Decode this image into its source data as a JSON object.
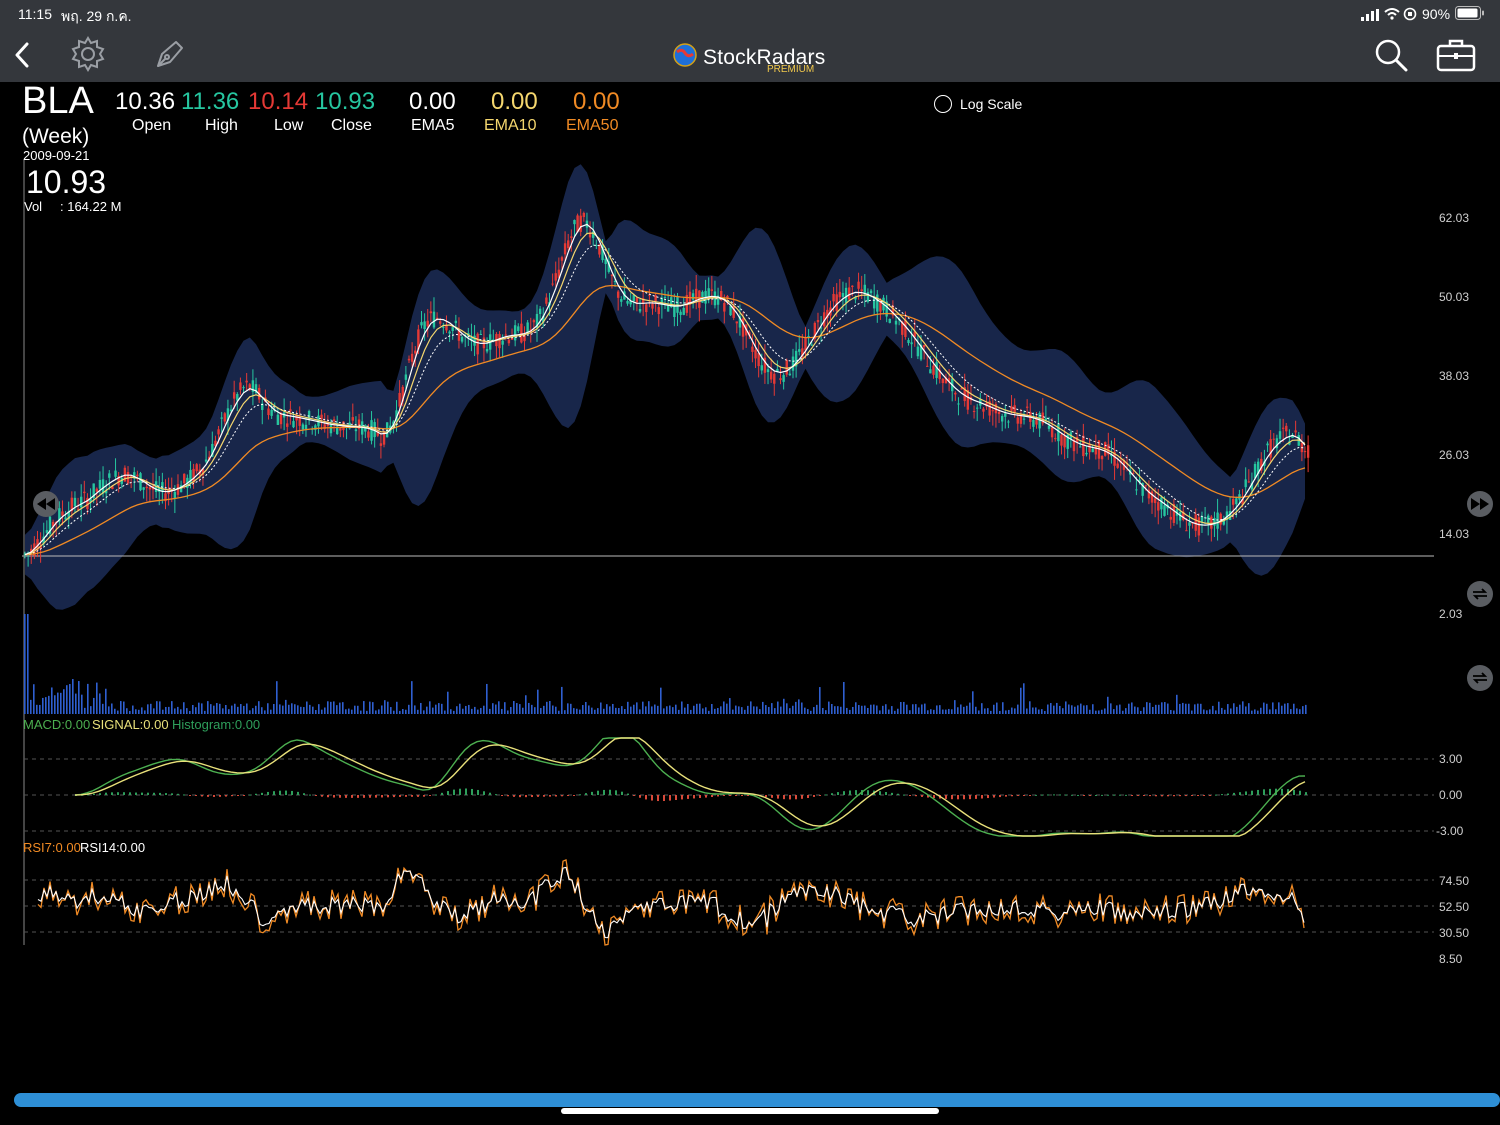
{
  "status_bar": {
    "time": "11:15",
    "date": "พฤ. 29 ก.ค.",
    "battery": "90%"
  },
  "navbar": {
    "brand": "StockRadars",
    "brand_sub": "PREMIUM",
    "icons": [
      "back-chevron-icon",
      "gear-icon",
      "pen-icon",
      "search-icon",
      "briefcase-icon"
    ]
  },
  "quote": {
    "symbol": "BLA",
    "period": "(Week)",
    "date": "2009-09-21",
    "last": "10.93",
    "vol_label": "Vol",
    "vol_value": ": 164.22 M",
    "open": "10.36",
    "open_label": "Open",
    "high": "11.36",
    "high_label": "High",
    "low": "10.14",
    "low_label": "Low",
    "close": "10.93",
    "close_label": "Close",
    "ema5": "0.00",
    "ema5_label": "EMA5",
    "ema10": "0.00",
    "ema10_label": "EMA10",
    "ema50": "0.00",
    "ema50_label": "EMA50"
  },
  "options": {
    "log_scale_label": "Log Scale",
    "log_scale_checked": false
  },
  "colors": {
    "up": "#26c6a0",
    "down": "#e53935",
    "ema5": "#ffffff",
    "ema10": "#f5d76e",
    "ema50": "#f08a24",
    "band": "#1b2a52",
    "volume": "#2f5fd0",
    "macd": "#4caf50",
    "signal": "#e8e07a",
    "rsi7": "#f08a24",
    "rsi14": "#ffffff"
  },
  "price_axis": [
    "62.03",
    "50.03",
    "38.03",
    "26.03",
    "14.03",
    "2.03"
  ],
  "macd_axis": [
    "3.00",
    "0.00",
    "-3.00"
  ],
  "rsi_axis": [
    "74.50",
    "52.50",
    "30.50",
    "8.50"
  ],
  "macd_legend": {
    "macd": "MACD:0.00",
    "signal": "SIGNAL:0.00",
    "hist": "Histogram:0.00"
  },
  "rsi_legend": {
    "rsi7": "RSI7:0.00",
    "rsi14": "RSI14:0.00"
  },
  "chart_data": {
    "type": "line",
    "title": "",
    "ylim": [
      2.03,
      62.03
    ],
    "series": [
      {
        "name": "Close",
        "values": [
          11.0,
          11.6,
          12.8,
          13.9,
          15.2,
          16.4,
          17.2,
          17.8,
          18.5,
          18.9,
          19.4,
          20.3,
          21.1,
          21.8,
          22.4,
          22.9,
          23.2,
          23.0,
          22.4,
          21.8,
          21.1,
          20.6,
          20.4,
          20.5,
          20.9,
          21.4,
          22.1,
          22.9,
          23.9,
          25.2,
          27.0,
          29.2,
          31.4,
          33.4,
          35.0,
          36.1,
          36.4,
          35.6,
          34.3,
          33.2,
          32.4,
          32.0,
          31.9,
          31.8,
          31.6,
          31.4,
          31.2,
          31.0,
          30.8,
          30.6,
          30.5,
          30.4,
          30.3,
          30.3,
          30.2,
          30.0,
          29.6,
          29.0,
          29.4,
          31.2,
          34.0,
          37.4,
          40.8,
          43.6,
          45.6,
          46.7,
          46.9,
          46.5,
          45.8,
          44.9,
          44.0,
          43.3,
          42.9,
          42.8,
          43.0,
          43.4,
          43.8,
          44.1,
          44.2,
          44.3,
          44.5,
          45.0,
          46.0,
          47.6,
          49.8,
          52.4,
          55.3,
          58.1,
          60.2,
          61.3,
          61.1,
          59.7,
          57.5,
          55.0,
          52.6,
          50.7,
          49.5,
          48.9,
          48.8,
          49.0,
          49.1,
          49.0,
          48.8,
          48.6,
          48.5,
          48.6,
          49.0,
          49.4,
          49.8,
          50.0,
          50.1,
          49.9,
          49.3,
          48.3,
          46.9,
          45.2,
          43.3,
          41.5,
          40.0,
          38.9,
          38.4,
          38.4,
          38.9,
          39.8,
          41.0,
          42.4,
          44.0,
          45.6,
          47.1,
          48.4,
          49.4,
          50.1,
          50.6,
          50.8,
          50.6,
          50.2,
          49.6,
          48.9,
          48.1,
          47.1,
          46.1,
          45.0,
          43.8,
          42.5,
          41.2,
          39.9,
          38.7,
          37.6,
          36.6,
          35.7,
          35.0,
          34.5,
          34.1,
          33.8,
          33.4,
          33.0,
          32.6,
          32.3,
          32.1,
          32.0,
          31.9,
          31.7,
          31.4,
          31.0,
          30.4,
          29.7,
          29.0,
          28.4,
          27.9,
          27.5,
          27.3,
          27.1,
          26.9,
          26.5,
          25.9,
          25.1,
          24.1,
          23.0,
          21.9,
          20.9,
          20.0,
          19.3,
          18.7,
          18.0,
          17.3,
          16.6,
          16.0,
          15.6,
          15.4,
          15.4,
          15.6,
          16.0,
          16.6,
          17.5,
          18.6,
          20.0,
          21.6,
          23.3,
          25.0,
          26.5,
          27.7,
          28.5,
          29.0,
          29.2,
          28.4,
          27.0
        ]
      }
    ]
  }
}
